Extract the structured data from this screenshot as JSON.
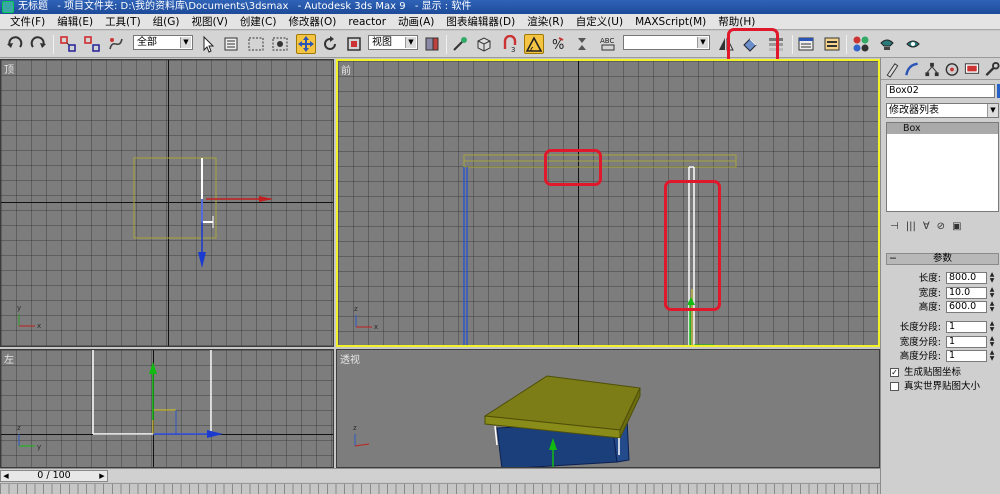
{
  "titlebar": {
    "doc_title": "无标题",
    "project_folder": "- 项目文件夹: D:\\我的资料库\\Documents\\3dsmax",
    "app_name": "- Autodesk 3ds Max 9",
    "display": "- 显示 : 软件"
  },
  "menu": [
    "文件(F)",
    "编辑(E)",
    "工具(T)",
    "组(G)",
    "视图(V)",
    "创建(C)",
    "修改器(O)",
    "reactor",
    "动画(A)",
    "图表编辑器(D)",
    "渲染(R)",
    "自定义(U)",
    "MAXScript(M)",
    "帮助(H)"
  ],
  "toolbar": {
    "selection_filter": "全部",
    "reference_coord": "视图",
    "named_selection": "",
    "align_tooltip": "对齐"
  },
  "viewports": {
    "top": {
      "label": "顶"
    },
    "front": {
      "label": "前"
    },
    "left": {
      "label": "左"
    },
    "perspective": {
      "label": "透视"
    }
  },
  "command_panel": {
    "object_name": "Box02",
    "object_color": "#2661c6",
    "modifier_list": "修改器列表",
    "stack_item": "Box",
    "rollout_title": "参数",
    "params": [
      {
        "label": "长度:",
        "value": "800.0"
      },
      {
        "label": "宽度:",
        "value": "10.0"
      },
      {
        "label": "高度:",
        "value": "600.0"
      }
    ],
    "segments": [
      {
        "label": "长度分段:",
        "value": "1"
      },
      {
        "label": "宽度分段:",
        "value": "1"
      },
      {
        "label": "高度分段:",
        "value": "1"
      }
    ],
    "checks": [
      {
        "label": "生成贴图坐标",
        "checked": true
      },
      {
        "label": "真实世界贴图大小",
        "checked": false
      }
    ]
  },
  "timeline": {
    "frame": "0 / 100"
  },
  "colors": {
    "active_border": "#f1f12a",
    "highlight_red": "#e0182c",
    "tabletop": "#7c7d16",
    "legs": "#1b3f7a"
  }
}
